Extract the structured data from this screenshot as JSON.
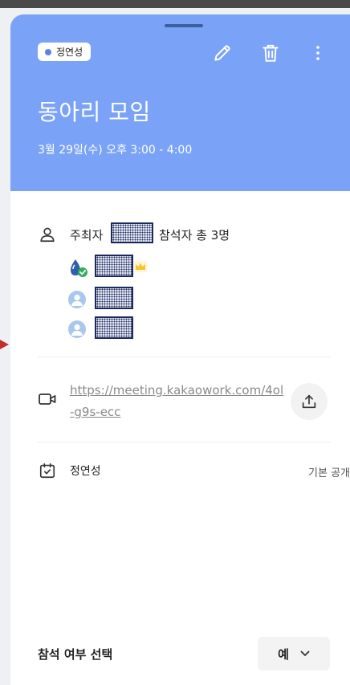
{
  "header": {
    "owner_name": "정연성",
    "title": "동아리 모임",
    "datetime": "3월 29일(수) 오후 3:00 - 4:00",
    "actions": [
      "pencil-icon",
      "trash-icon",
      "more-vertical-icon"
    ]
  },
  "participants": {
    "host_label": "주최자",
    "attendee_summary": "참석자 총 3명"
  },
  "video_meeting": {
    "link": "https://meeting.kakaowork.com/4ol-g9s-ecc",
    "share_icon": "share-upload-icon"
  },
  "calendar": {
    "owner": "정연성",
    "visibility": "기본 공개"
  },
  "attendance": {
    "label": "참석 여부 선택",
    "selected": "예"
  },
  "colors": {
    "header_bg": "#7aa2f7",
    "badge_dot": "#5b83e8",
    "crown": "#f7c32e",
    "check": "#2fae5a",
    "redaction": "#1b2a5e"
  }
}
